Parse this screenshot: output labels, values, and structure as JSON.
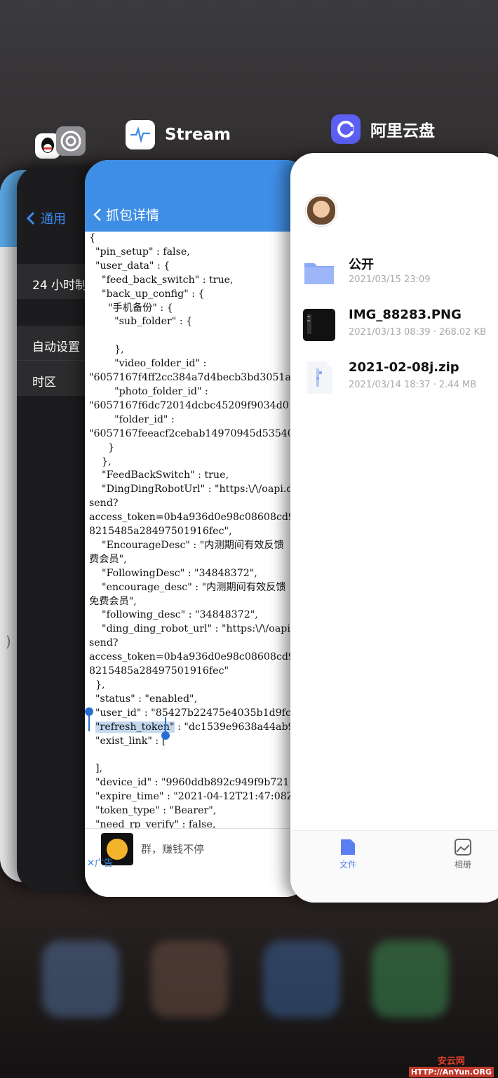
{
  "app_switcher": {
    "stream_label": "Stream",
    "aliyun_label": "阿里云盘"
  },
  "settings_card": {
    "back_label": "通用",
    "rows": [
      "24 小时制",
      "自动设置",
      "时区"
    ]
  },
  "stream_card": {
    "back_label": "抓包详情",
    "json_lines": [
      "{",
      "  \"pin_setup\" : false,",
      "  \"user_data\" : {",
      "    \"feed_back_switch\" : true,",
      "    \"back_up_config\" : {",
      "      \"手机备份\" : {",
      "        \"sub_folder\" : {",
      "",
      "        },",
      "        \"video_folder_id\" :",
      "\"6057167f4ff2cc384a7d4becb3bd3051a",
      "        \"photo_folder_id\" :",
      "\"6057167f6dc72014dcbc45209f9034d0",
      "        \"folder_id\" :",
      "\"6057167feeacf2cebab14970945d53540",
      "      }",
      "    },",
      "    \"FeedBackSwitch\" : true,",
      "    \"DingDingRobotUrl\" : \"https:\\/\\/oapi.d",
      "send?",
      "access_token=0b4a936d0e98c08608cd9",
      "8215485a28497501916fec\",",
      "    \"EncourageDesc\" : \"内测期间有效反馈",
      "费会员\",",
      "    \"FollowingDesc\" : \"34848372\",",
      "    \"encourage_desc\" : \"内测期间有效反馈",
      "免费会员\",",
      "    \"following_desc\" : \"34848372\",",
      "    \"ding_ding_robot_url\" : \"https:\\/\\/oapi",
      "send?",
      "access_token=0b4a936d0e98c08608cd9",
      "8215485a28497501916fec\"",
      "  },",
      "  \"status\" : \"enabled\",",
      "  \"user_id\" : \"85427b22475e4035b1d9fc4",
      "  \"refresh_token\" : \"dc1539e9638a44ab9",
      "  \"exist_link\" : [",
      "",
      "  ],",
      "  \"device_id\" : \"9960ddb892c949f9b7211",
      "  \"expire_time\" : \"2021-04-12T21:47:08Z",
      "  \"token_type\" : \"Bearer\",",
      "  \"need_rp_verify\" : false,"
    ],
    "ad_text": "群，赚钱不停",
    "ad_tag": "✕广告"
  },
  "aliyun_card": {
    "files": [
      {
        "name": "公开",
        "meta": "2021/03/15 23:09",
        "icon": "folder-icon"
      },
      {
        "name": "IMG_88283.PNG",
        "meta": "2021/03/13 08:39 · 268.02 KB",
        "icon": "image-file-icon"
      },
      {
        "name": "2021-02-08j.zip",
        "meta": "2021/03/14 18:37 · 2.44 MB",
        "icon": "zip-file-icon"
      }
    ],
    "tabs": {
      "files": "文件",
      "album": "相册"
    }
  },
  "watermark": {
    "line1": "安云网",
    "line2": "HTTP://AnYun.ORG"
  },
  "colors": {
    "stream_blue": "#3f8ee6",
    "ios_blue": "#3b8cf7",
    "aliyun_folder": "#8aa8f5"
  }
}
